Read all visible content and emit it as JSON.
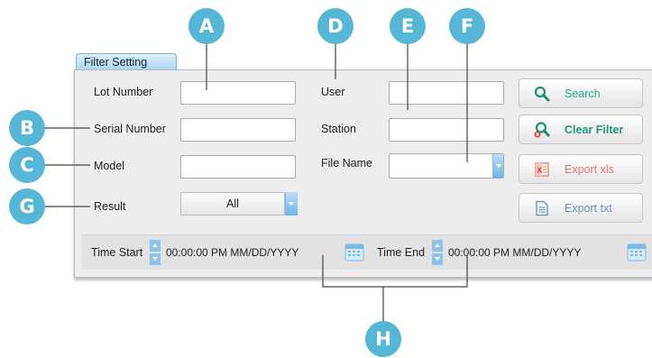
{
  "tab": {
    "label": "Filter Setting"
  },
  "fields": {
    "lot_number": {
      "label": "Lot Number",
      "value": ""
    },
    "serial_number": {
      "label": "Serial Number",
      "value": ""
    },
    "model": {
      "label": "Model",
      "value": ""
    },
    "result": {
      "label": "Result",
      "value": "All"
    },
    "user": {
      "label": "User",
      "value": ""
    },
    "station": {
      "label": "Station",
      "value": ""
    },
    "file_name": {
      "label": "File Name",
      "value": ""
    }
  },
  "buttons": {
    "search": {
      "label": "Search",
      "icon": "search-icon",
      "color": "#23a98a"
    },
    "clear_filter": {
      "label": "Clear Filter",
      "icon": "clear-filter-icon",
      "color": "#1f9a7e"
    },
    "export_xls": {
      "label": "Export xls",
      "icon": "excel-file-icon",
      "color": "#e4786b"
    },
    "export_txt": {
      "label": "Export txt",
      "icon": "text-file-icon",
      "color": "#6d8fb5"
    }
  },
  "time": {
    "start_label": "Time Start",
    "start_value": "00:00:00 PM MM/DD/YYYY",
    "end_label": "Time End",
    "end_value": "00:00:00 PM MM/DD/YYYY"
  },
  "callouts": {
    "A": "A",
    "B": "B",
    "C": "C",
    "D": "D",
    "E": "E",
    "F": "F",
    "G": "G",
    "H": "H"
  },
  "colors": {
    "callout": "#56b6d6",
    "tab": "#a9d4f1",
    "spinner": "#8cc3ec"
  }
}
